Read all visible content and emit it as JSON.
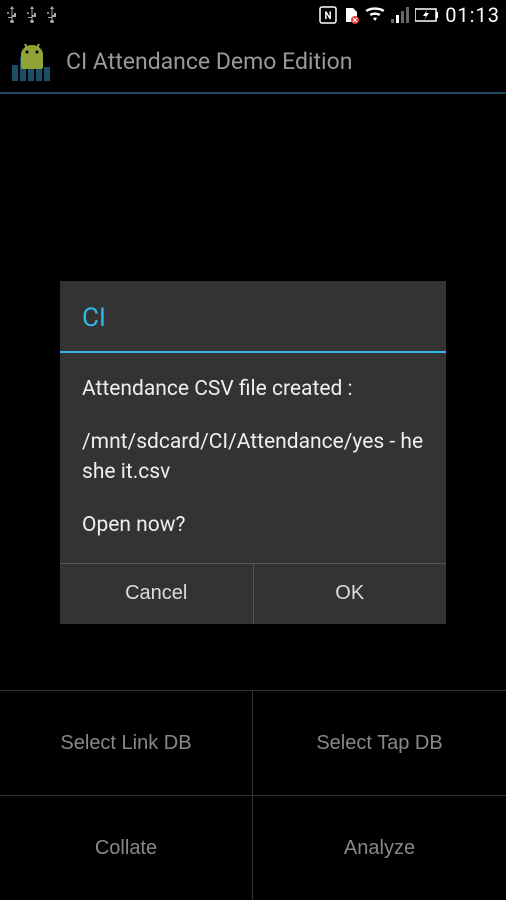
{
  "status": {
    "time": "01:13"
  },
  "app": {
    "title": "CI Attendance Demo Edition"
  },
  "buttons": {
    "selectLinkDB": "Select Link DB",
    "selectTapDB": "Select Tap DB",
    "collate": "Collate",
    "analyze": "Analyze"
  },
  "dialog": {
    "title": "CI",
    "message1": "Attendance CSV file created :",
    "message2": "/mnt/sdcard/CI/Attendance/yes - he she it.csv",
    "message3": "Open now?",
    "cancel": "Cancel",
    "ok": "OK"
  }
}
